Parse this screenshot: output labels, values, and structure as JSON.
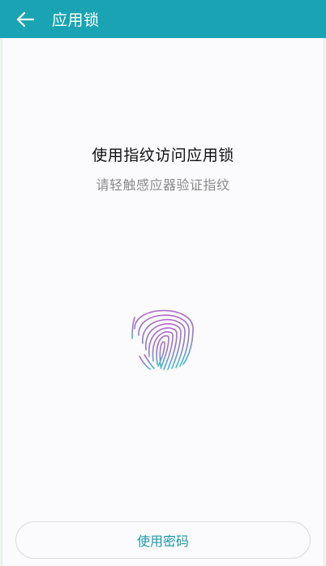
{
  "header": {
    "title": "应用锁",
    "back_icon": "arrow-left-icon"
  },
  "main": {
    "heading": "使用指纹访问应用锁",
    "subheading": "请轻触感应器验证指纹",
    "fingerprint_icon": "fingerprint-icon"
  },
  "footer": {
    "password_button_label": "使用密码"
  },
  "colors": {
    "toolbar": "#1aa4b3",
    "button_text": "#1a9aa8",
    "fingerprint_top": "#b06ac8",
    "fingerprint_bottom": "#3cc0c8"
  }
}
